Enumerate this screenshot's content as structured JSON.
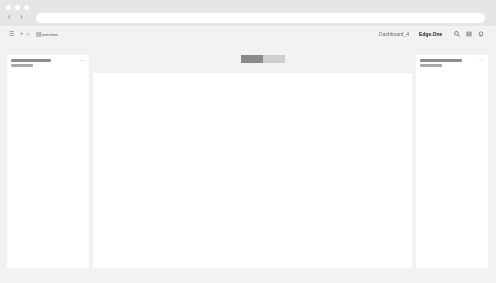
{
  "browser": {
    "back_icon": "chevron-left-icon",
    "forward_icon": "chevron-right-icon",
    "address_value": ""
  },
  "toolbar": {
    "label": "overview",
    "icons": [
      "menu-icon",
      "plus-icon",
      "pin-icon",
      "layout-icon"
    ]
  },
  "header_right": {
    "dashboard_title": "Dashboard_4",
    "brand": "Edge.One",
    "icons": [
      "search-icon",
      "grid-icon",
      "bell-icon"
    ]
  },
  "colors": {
    "background": "#f2f2f2",
    "panel": "#ffffff",
    "placeholder_dark": "#8a8a8a",
    "placeholder_light": "#cfcfcf"
  }
}
